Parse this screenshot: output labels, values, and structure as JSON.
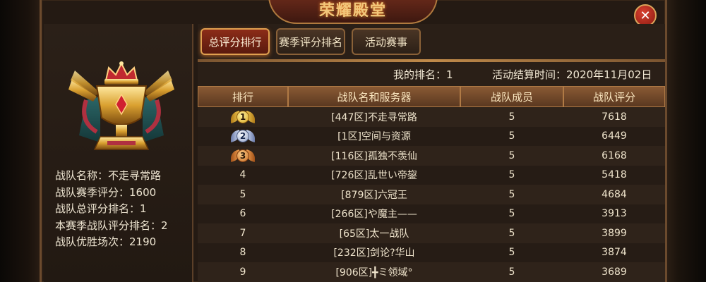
{
  "title": "荣耀殿堂",
  "tabs": [
    {
      "label": "总评分排行",
      "active": true
    },
    {
      "label": "赛季评分排名",
      "active": false
    },
    {
      "label": "活动赛事",
      "active": false
    }
  ],
  "team": {
    "name_label": "战队名称：不走寻常路",
    "season_score_label": "战队赛季评分：1600",
    "total_rank_label": "战队总评分排名：1",
    "season_rank_label": "本赛季战队评分排名：2",
    "wins_label": "战队优胜场次：2190"
  },
  "meta": {
    "my_rank": "我的排名：1",
    "settle_time": "活动结算时间：2020年11月02日"
  },
  "table": {
    "headers": [
      "排行",
      "战队名和服务器",
      "战队成员",
      "战队评分"
    ],
    "rows": [
      {
        "rank": "1",
        "medal": "gold",
        "name": "[447区]不走寻常路",
        "members": "5",
        "score": "7618"
      },
      {
        "rank": "2",
        "medal": "silver",
        "name": "[1区]空间与资源",
        "members": "5",
        "score": "6449"
      },
      {
        "rank": "3",
        "medal": "bronze",
        "name": "[116区]孤独不羡仙",
        "members": "5",
        "score": "6168"
      },
      {
        "rank": "4",
        "medal": "",
        "name": "[726区]乱世い帝鋆",
        "members": "5",
        "score": "5418"
      },
      {
        "rank": "5",
        "medal": "",
        "name": "[879区]六冠王",
        "members": "5",
        "score": "4684"
      },
      {
        "rank": "6",
        "medal": "",
        "name": "[266区]や魔主——",
        "members": "5",
        "score": "3913"
      },
      {
        "rank": "7",
        "medal": "",
        "name": "[65区]太一战队",
        "members": "5",
        "score": "3899"
      },
      {
        "rank": "8",
        "medal": "",
        "name": "[232区]剑论?华山",
        "members": "5",
        "score": "3874"
      },
      {
        "rank": "9",
        "medal": "",
        "name": "[906区]╋ミ领域°",
        "members": "5",
        "score": "3689"
      }
    ]
  },
  "icons": {
    "close": "close-icon",
    "trophy": "trophy-crown-icon"
  },
  "colors": {
    "accent_gold": "#f3c77a",
    "tab_active": "#8c2c18",
    "header_bg": "#8a5a34",
    "close_red": "#c83020"
  }
}
